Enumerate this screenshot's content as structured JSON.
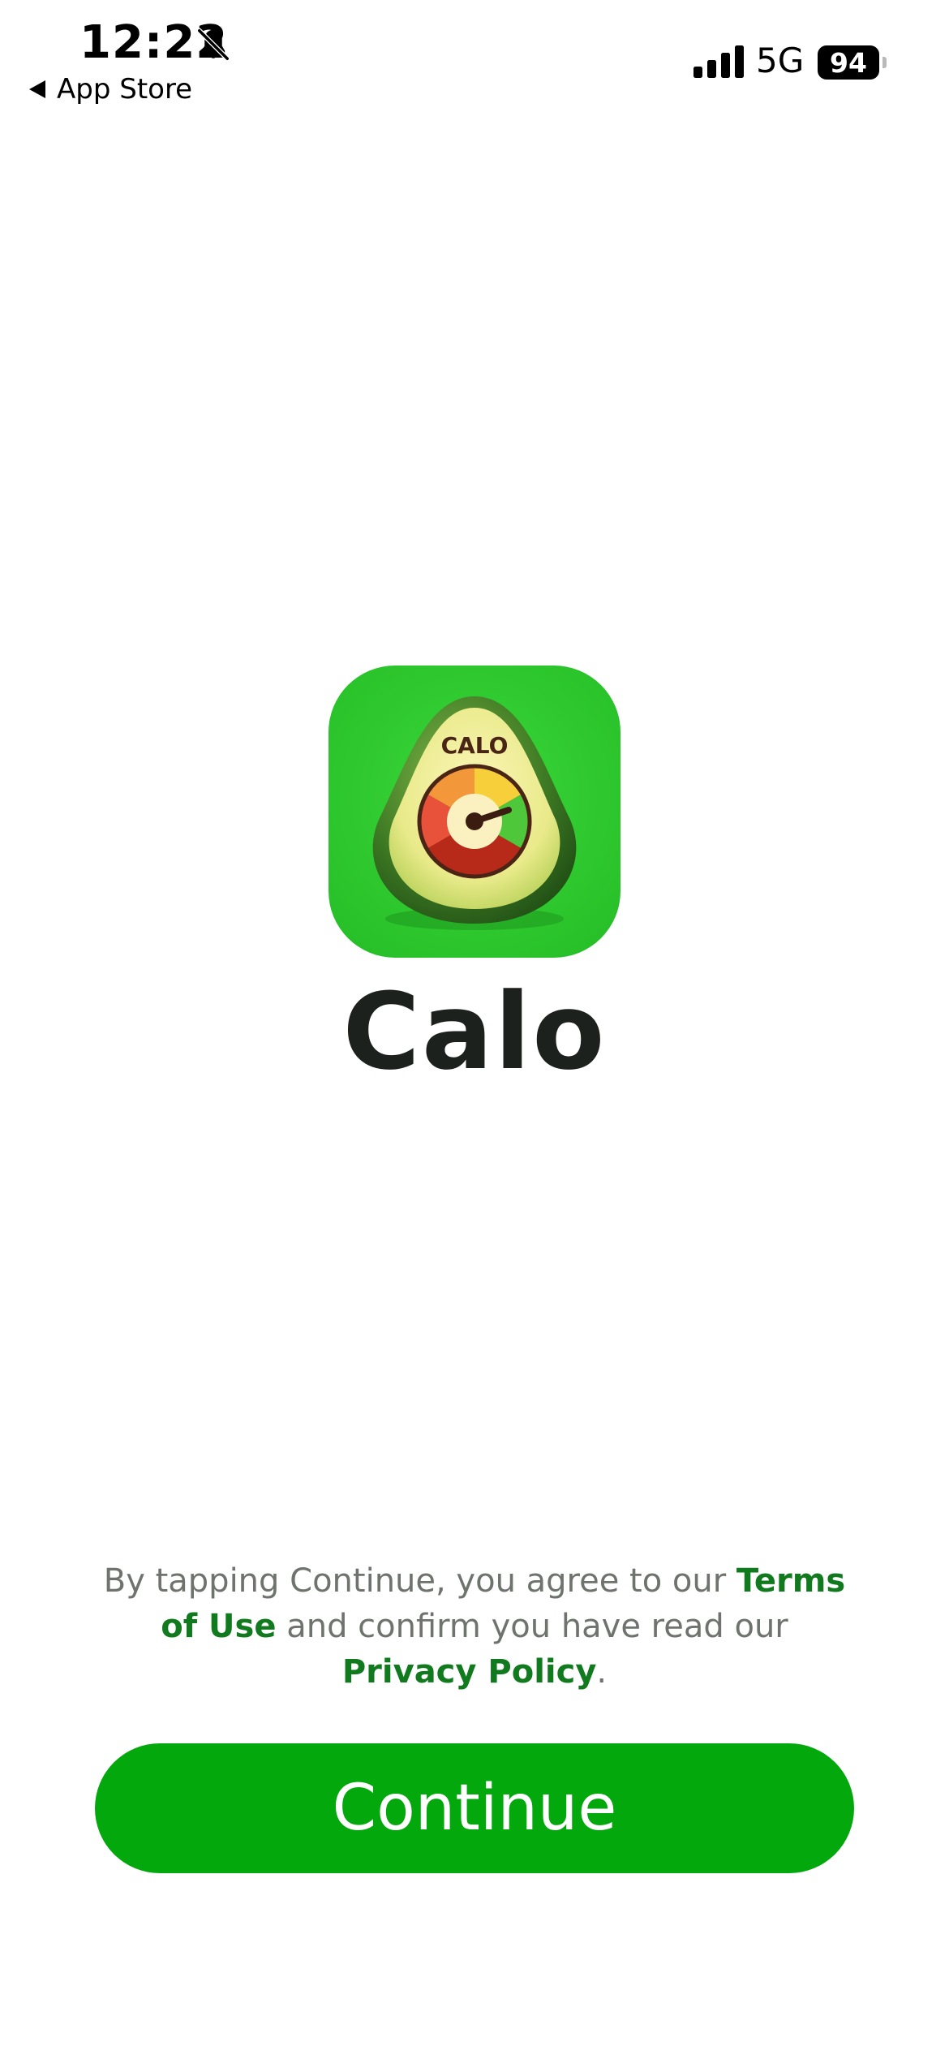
{
  "status_bar": {
    "time": "12:22",
    "back_label": "App Store",
    "network": "5G",
    "battery": "94",
    "icons": [
      "bell-slash-icon",
      "signal-icon"
    ]
  },
  "brand": {
    "icon_text": "CALO",
    "app_name": "Calo",
    "icon_bg": "#2dc72c"
  },
  "legal": {
    "part1": "By tapping Continue, you agree to our ",
    "terms_link": "Terms of Use",
    "part2": " and confirm you have read our ",
    "privacy_link": "Privacy Policy",
    "part3": "."
  },
  "continue_button": {
    "label": "Continue",
    "color": "#03a80c"
  }
}
